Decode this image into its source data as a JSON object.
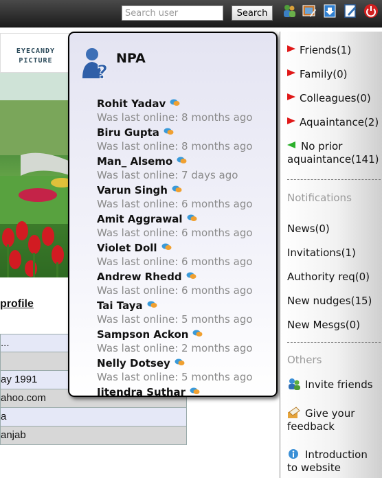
{
  "search": {
    "placeholder": "Search user",
    "button_label": "Search"
  },
  "toolbar_icons": [
    "users-icon",
    "photo-edit-icon",
    "download-icon",
    "edit-icon",
    "power-icon"
  ],
  "profile": {
    "logo_line1": "EYECANDY",
    "logo_line2": "PICTURE",
    "link_label": "profile",
    "rows": [
      "...",
      "",
      "ay 1991",
      "ahoo.com",
      "a",
      "anjab"
    ]
  },
  "popup": {
    "title": "NPA",
    "friends": [
      {
        "name": "Rohit Yadav",
        "status": "Was last online: 8 months ago"
      },
      {
        "name": "Biru Gupta",
        "status": "Was last online: 8 months ago"
      },
      {
        "name": "Man_ Alsemo",
        "status": "Was last online: 7 days ago"
      },
      {
        "name": "Varun Singh",
        "status": "Was last online: 6 months ago"
      },
      {
        "name": "Amit Aggrawal",
        "status": "Was last online: 6 months ago"
      },
      {
        "name": "Violet Doll",
        "status": "Was last online: 6 months ago"
      },
      {
        "name": "Andrew Rhedd",
        "status": "Was last online: 6 months ago"
      },
      {
        "name": "Tai Taya",
        "status": "Was last online: 5 months ago"
      },
      {
        "name": "Sampson Ackon",
        "status": "Was last online: 2 months ago"
      },
      {
        "name": "Nelly Dotsey",
        "status": "Was last online: 5 months ago"
      },
      {
        "name": "Jitendra Suthar",
        "status": ""
      }
    ]
  },
  "sidebar": {
    "groups": [
      {
        "label": "Friends(1)"
      },
      {
        "label": "Family(0)"
      },
      {
        "label": "Colleagues(0)"
      },
      {
        "label": "Aquaintance(2)"
      },
      {
        "label": "No prior aquaintance(141)"
      }
    ],
    "notifications_heading": "Notifications",
    "notifications": [
      {
        "label": "News(0)"
      },
      {
        "label": "Invitations(1)"
      },
      {
        "label": "Authority req(0)"
      },
      {
        "label": "New nudges(15)"
      },
      {
        "label": "New Mesgs(0)"
      }
    ],
    "others_heading": "Others",
    "others": [
      {
        "label": "Invite friends"
      },
      {
        "label": "Give your feedback"
      },
      {
        "label": "Introduction to website"
      }
    ]
  },
  "colors": {
    "topbar": "#2a2a2a",
    "accent_red": "#e01818",
    "accent_green": "#2bb02b",
    "status_grey": "#8a8a8a"
  }
}
